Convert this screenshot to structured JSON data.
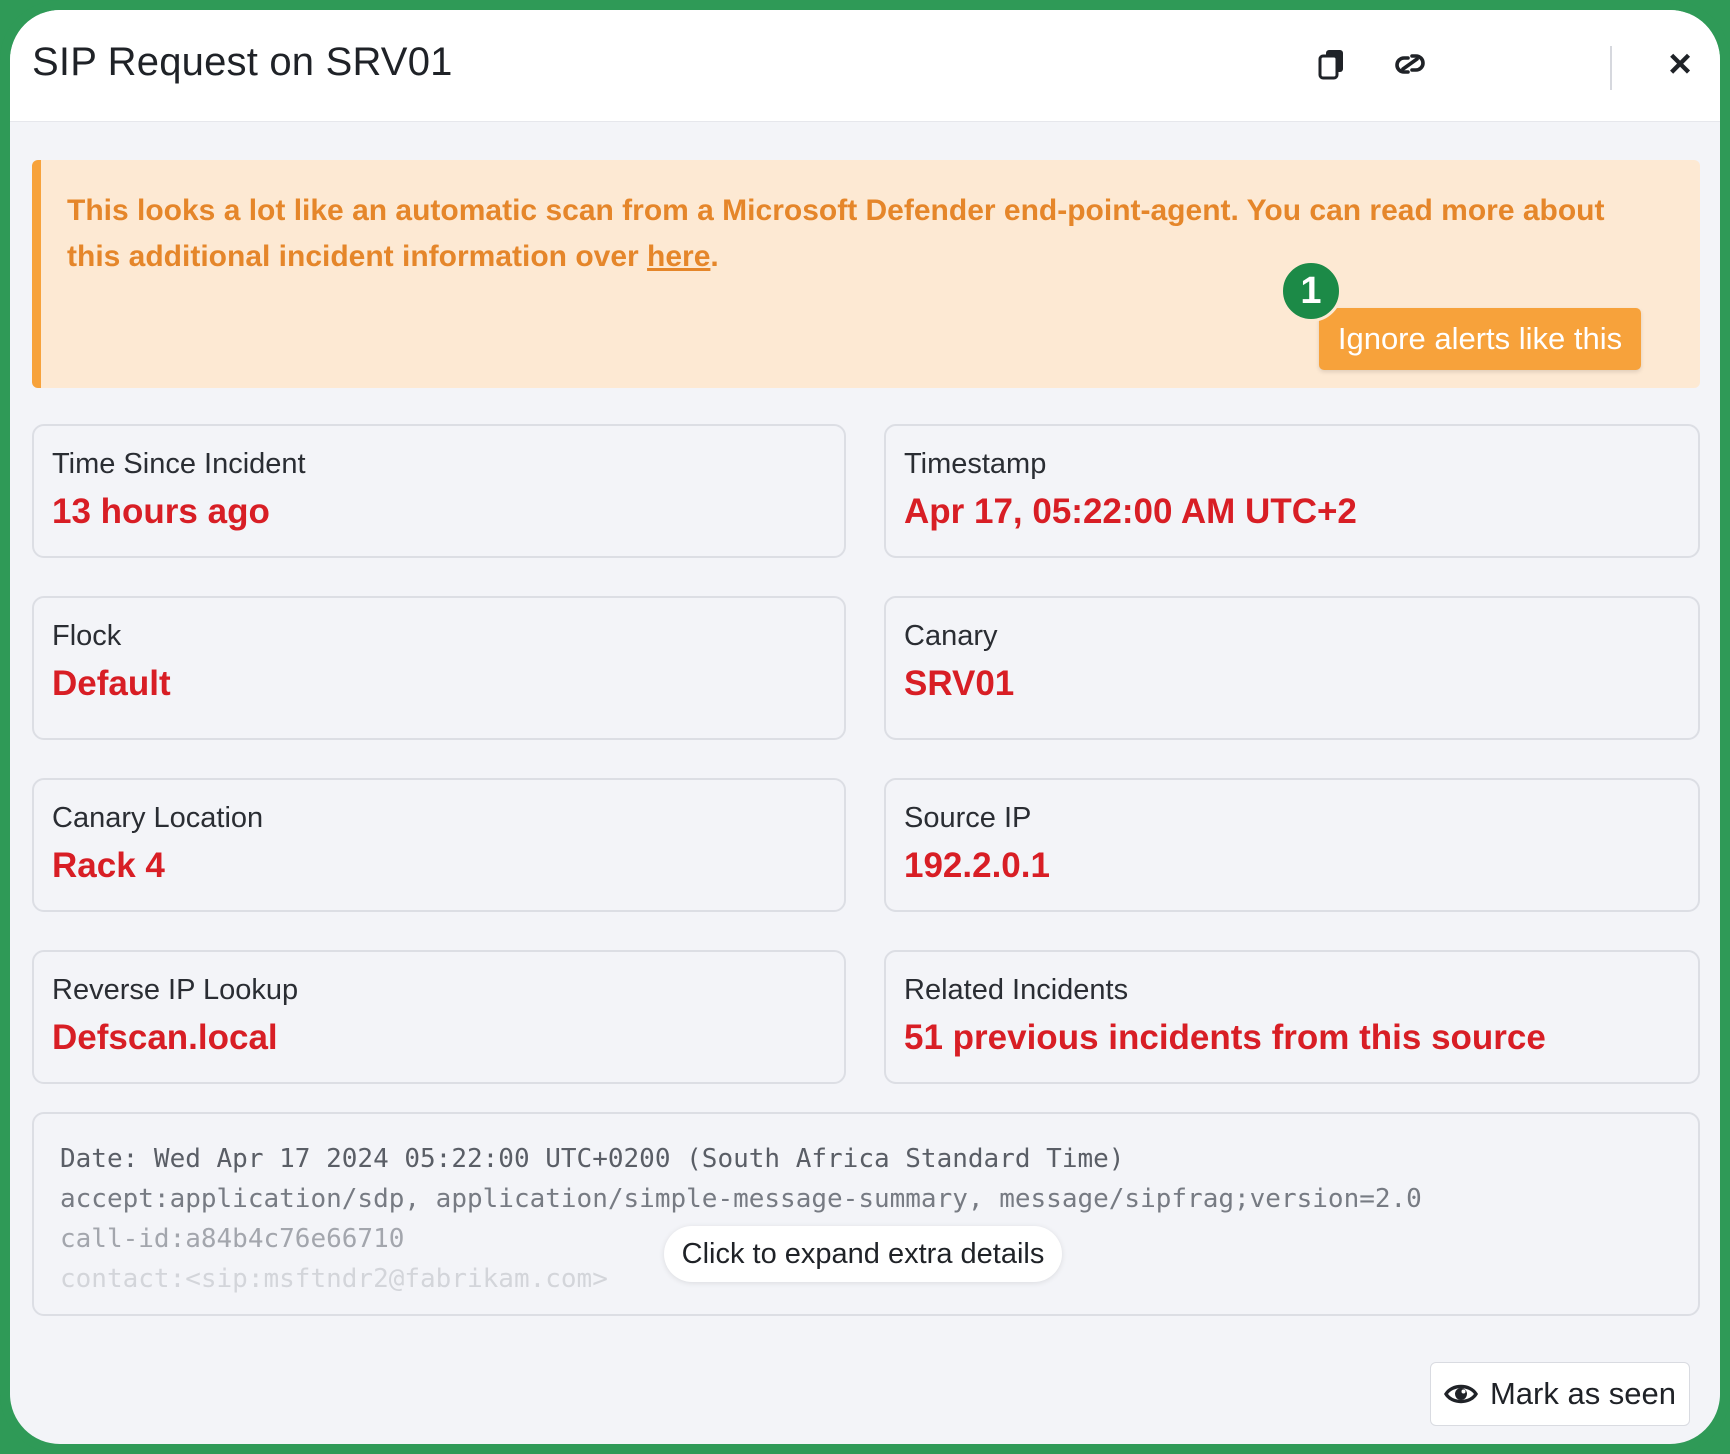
{
  "window": {
    "title": "SIP Request on SRV01",
    "icons": [
      "copy-icon",
      "link-icon",
      "close-icon"
    ],
    "close_symbol": "×"
  },
  "alert": {
    "text_main": "This looks a lot like an automatic scan from a Microsoft Defender end-point-agent. You can read more about this additional incident information over ",
    "link_text": "here",
    "text_end": ".",
    "ignore_button": "Ignore alerts like this",
    "step_badge": "1",
    "colors": {
      "background": "#fde9d3",
      "accent": "#f7a23b",
      "text": "#e5862a",
      "badge": "#1c8a47"
    }
  },
  "fields": [
    {
      "label": "Time Since Incident",
      "value": "13 hours ago"
    },
    {
      "label": "Timestamp",
      "value": "Apr 17, 05:22:00 AM UTC+2"
    },
    {
      "label": "Flock",
      "value": "Default"
    },
    {
      "label": "Canary",
      "value": "SRV01"
    },
    {
      "label": "Canary Location",
      "value": "Rack 4"
    },
    {
      "label": "Source IP",
      "value": "192.2.0.1"
    },
    {
      "label": "Reverse IP Lookup",
      "value": "Defscan.local"
    },
    {
      "label": "Related Incidents",
      "value": "51 previous incidents from this source"
    }
  ],
  "details": {
    "lines": [
      "Date: Wed Apr 17 2024 05:22:00 UTC+0200 (South Africa Standard Time)",
      "accept:application/sdp, application/simple-message-summary, message/sipfrag;version=2.0",
      "call-id:a84b4c76e66710",
      "contact:<sip:msftndr2@fabrikam.com>"
    ],
    "expand_label": "Click to expand extra details"
  },
  "footer": {
    "mark_seen": "Mark as seen",
    "mark_seen_icon": "eye-icon"
  },
  "colors": {
    "value_red": "#d81e25",
    "frame_green": "#2f9a57"
  }
}
